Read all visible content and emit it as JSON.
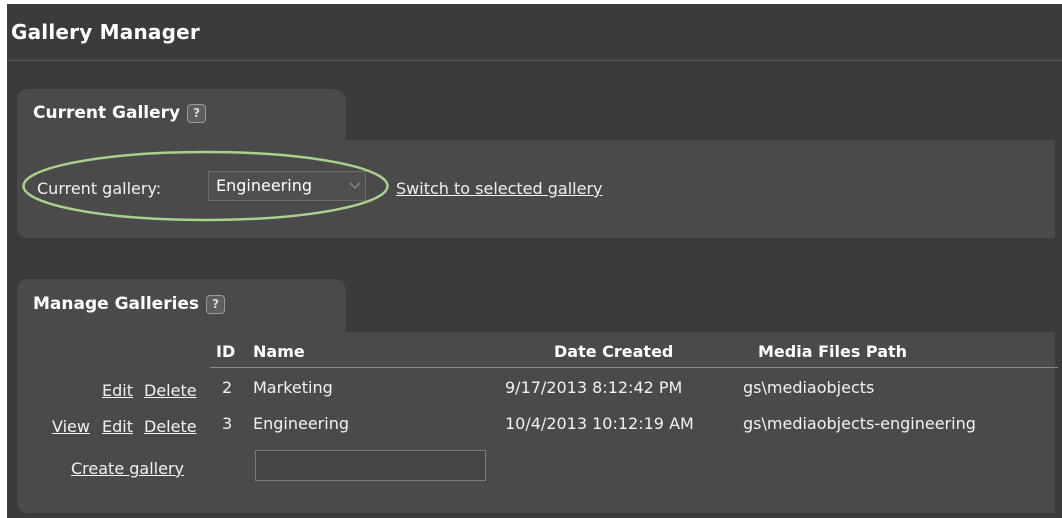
{
  "page": {
    "title": "Gallery Manager"
  },
  "current_gallery": {
    "heading": "Current Gallery",
    "help": "?",
    "label": "Current gallery:",
    "selected": "Engineering",
    "switch_link": "Switch to selected gallery",
    "highlight_color": "#a9d18e"
  },
  "manage": {
    "heading": "Manage Galleries",
    "help": "?",
    "columns": [
      "ID",
      "Name",
      "Date Created",
      "Media Files Path"
    ],
    "rows": [
      {
        "actions": [
          "Edit",
          "Delete"
        ],
        "id": "2",
        "name": "Marketing",
        "date": "9/17/2013 8:12:42 PM",
        "path": "gs\\mediaobjects"
      },
      {
        "actions": [
          "View",
          "Edit",
          "Delete"
        ],
        "id": "3",
        "name": "Engineering",
        "date": "10/4/2013 10:12:19 AM",
        "path": "gs\\mediaobjects-engineering"
      }
    ],
    "create_link": "Create gallery",
    "create_value": ""
  }
}
